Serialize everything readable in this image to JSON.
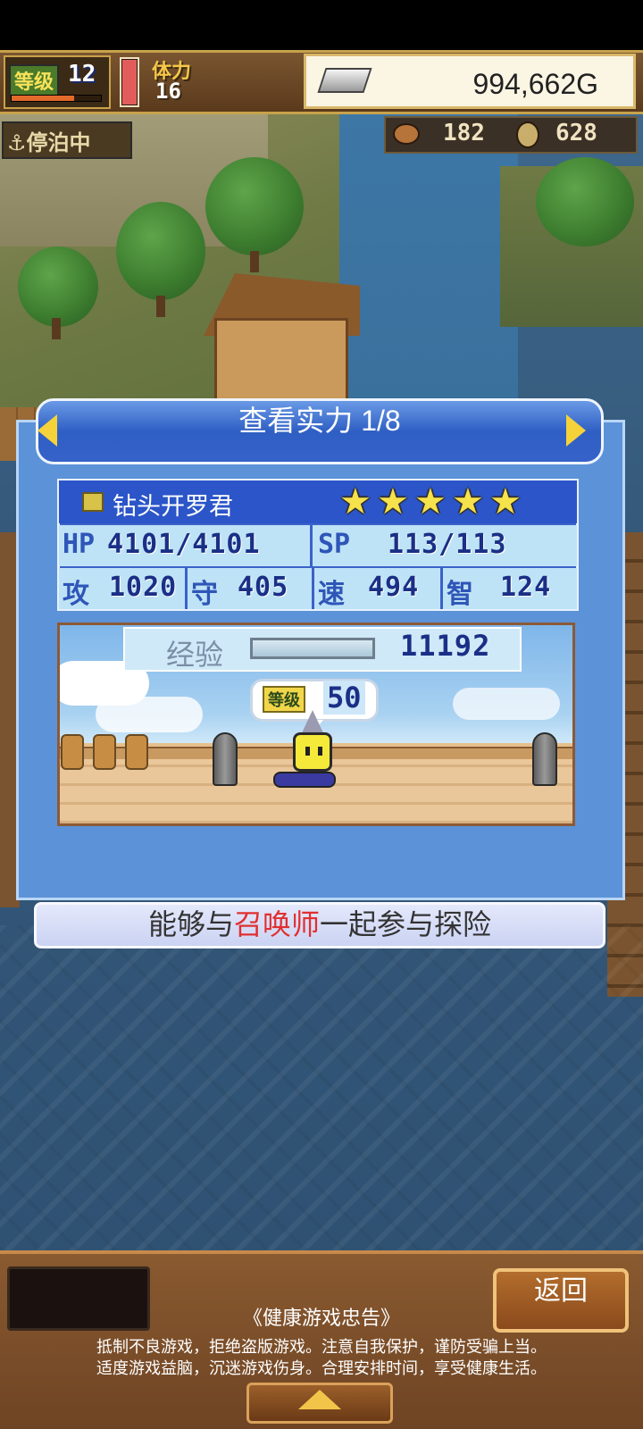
{
  "hud": {
    "level_label": "等级",
    "level": "12",
    "level_progress": 0.7,
    "stamina_label": "体力",
    "stamina": "16",
    "stamina_fill": 1.0,
    "gold": "994,662G",
    "status": "停泊中",
    "resource_a": "182",
    "resource_b": "628"
  },
  "panel": {
    "title": "查看实力 1/8",
    "character": {
      "name": "钻头开罗君",
      "stars": 5,
      "hp_label": "HP",
      "hp": "4101/4101",
      "sp_label": "SP",
      "sp": "113/113",
      "atk_label": "攻",
      "atk": "1020",
      "def_label": "守",
      "def": "405",
      "spd_label": "速",
      "spd": "494",
      "int_label": "智",
      "int": "124"
    },
    "exp_label": "经验",
    "exp": "11192",
    "level_label": "等级",
    "level": "50"
  },
  "description": {
    "before": "能够与",
    "highlight": "召唤师",
    "after": "一起参与探险",
    "highlight_color": "#e03030"
  },
  "footer": {
    "back_label": "返回",
    "advice_title": "《健康游戏忠告》",
    "advice_line1": "抵制不良游戏，拒绝盗版游戏。注意自我保护，谨防受骗上当。",
    "advice_line2": "适度游戏益脑，沉迷游戏伤身。合理安排时间，享受健康生活。"
  },
  "icons": {
    "anchor": "anchor-icon",
    "silver": "silver-ingot-icon",
    "arrow_left": "arrow-left-icon",
    "arrow_right": "arrow-right-icon",
    "star": "star-icon",
    "up": "up-arrow-icon"
  }
}
